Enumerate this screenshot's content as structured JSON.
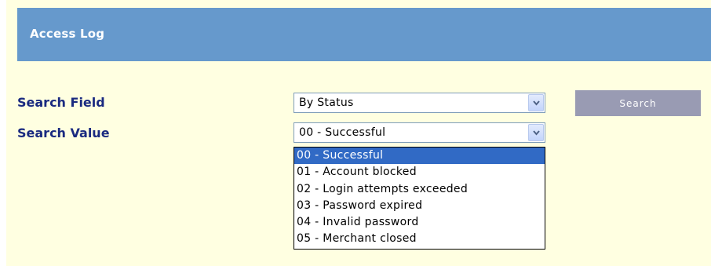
{
  "header": {
    "title": "Access Log"
  },
  "search": {
    "field_label": "Search Field",
    "value_label": "Search Value",
    "field_selected": "By Status",
    "value_selected": "00 - Successful",
    "button_label": "Search",
    "value_options": [
      "00 - Successful",
      "01 - Account blocked",
      "02 - Login attempts exceeded",
      "03 - Password expired",
      "04 - Invalid password",
      "05 - Merchant closed"
    ],
    "highlighted_option_index": 0
  },
  "colors": {
    "header_bg": "#6699cc",
    "panel_bg": "#ffffe1",
    "label_text": "#1a2a80",
    "button_bg": "#999bb3",
    "selection_bg": "#316ac5"
  },
  "icons": {
    "dropdown_arrow": "chevron-down-icon"
  }
}
